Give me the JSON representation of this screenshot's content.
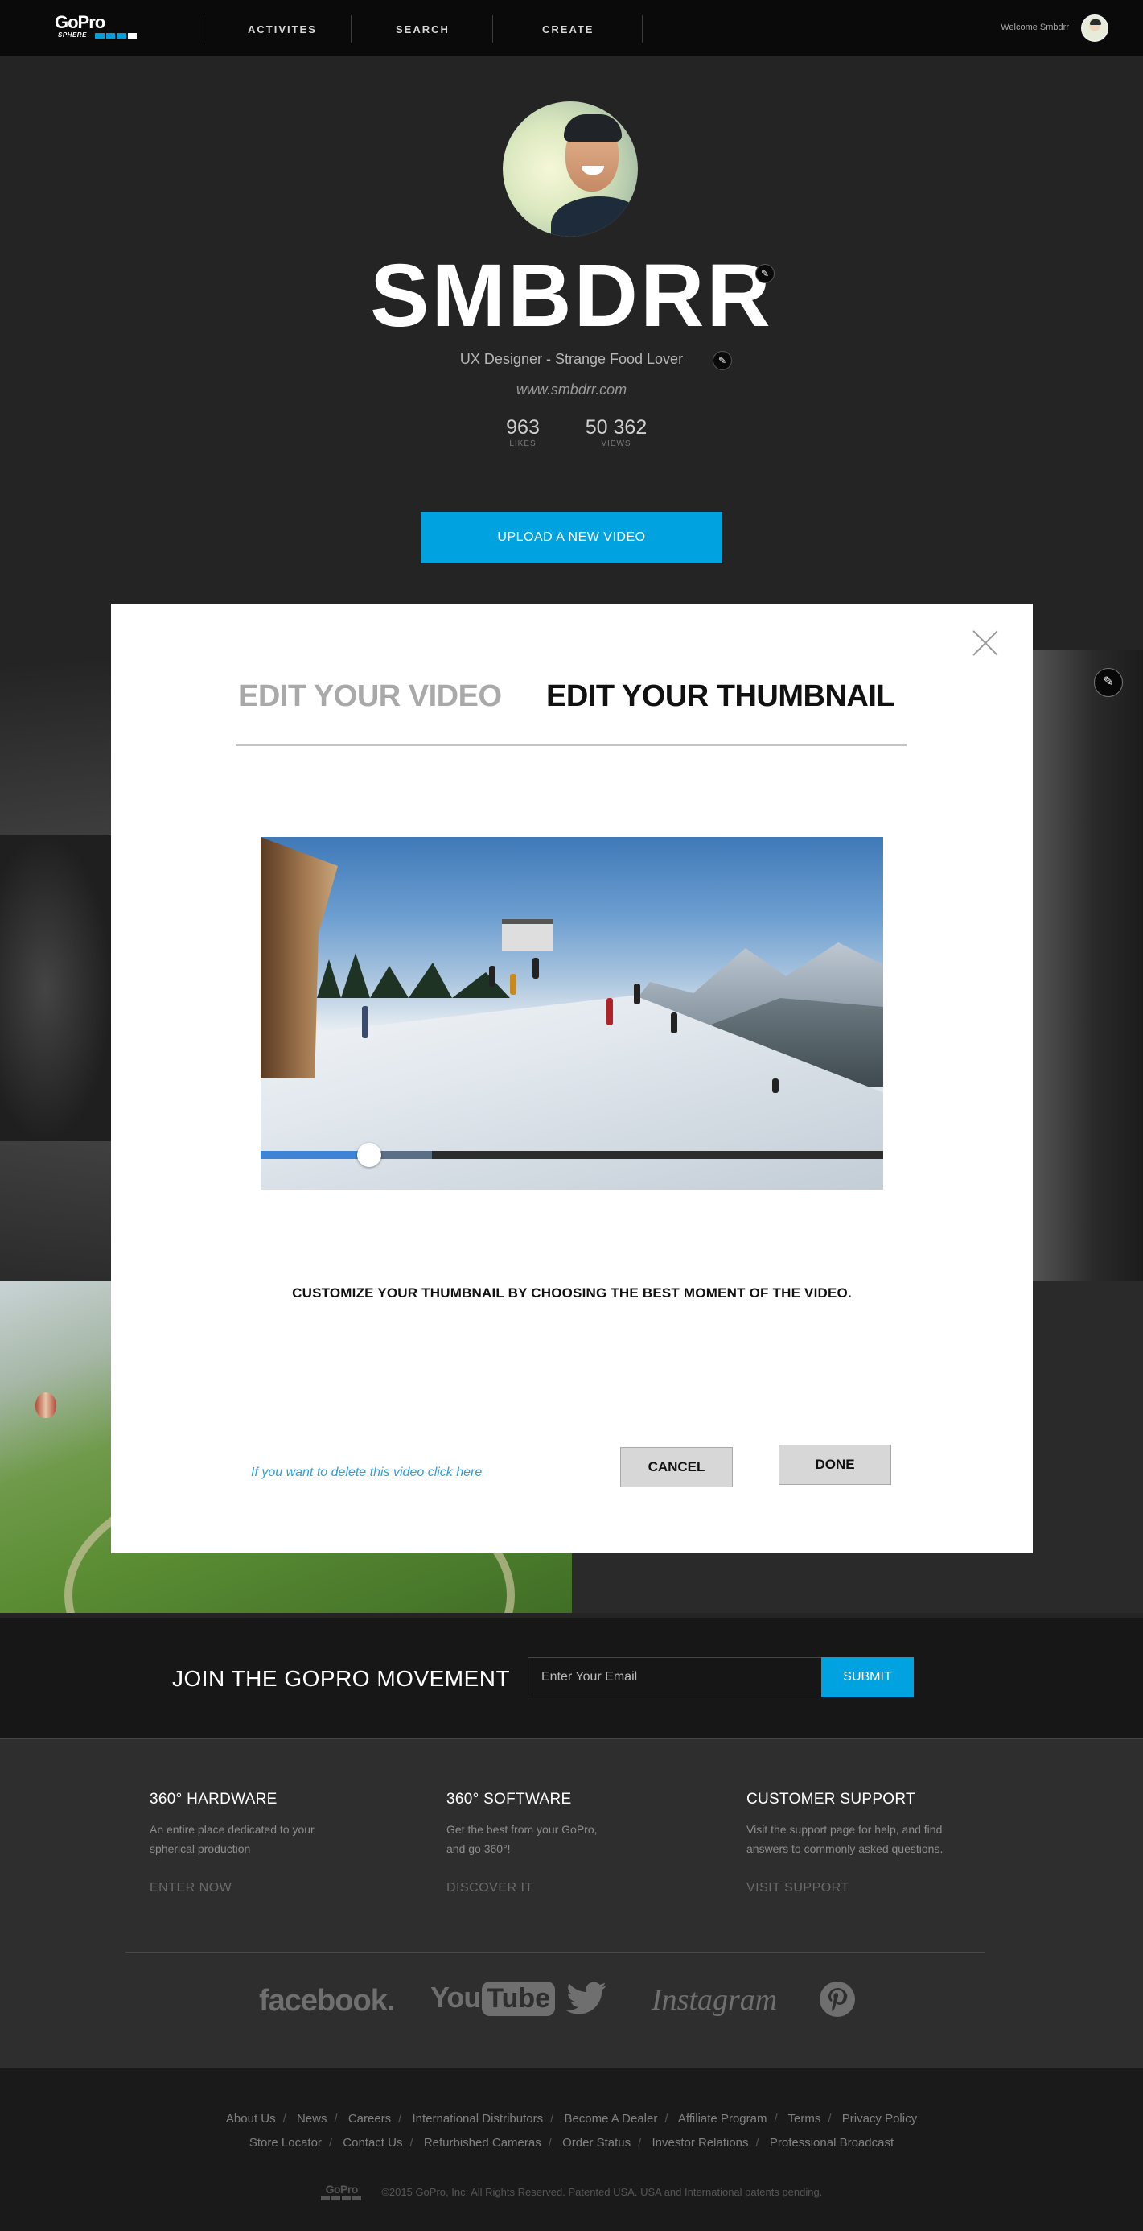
{
  "nav": {
    "brand": "GoPro",
    "brand_sub": "SPHERE",
    "links": [
      "ACTIVITES",
      "SEARCH",
      "CREATE"
    ],
    "welcome": "Welcome Smbdrr"
  },
  "profile": {
    "name": "SMBDRR",
    "bio": "UX Designer - Strange Food Lover",
    "website": "www.smbdrr.com",
    "likes": "963",
    "likes_label": "LIKES",
    "views": "50 362",
    "views_label": "VIEWS",
    "upload_label": "UPLOAD A NEW VIDEO"
  },
  "modal": {
    "tab_inactive": "EDIT YOUR VIDEO",
    "tab_active": "EDIT YOUR THUMBNAIL",
    "hint": "CUSTOMIZE YOUR THUMBNAIL BY CHOOSING THE BEST MOMENT OF THE VIDEO.",
    "delete_link": "If you want to delete this video click here",
    "cancel_label": "CANCEL",
    "done_label": "DONE",
    "scrubber_played_fraction": 0.175,
    "scrubber_buffered_fraction": 0.275
  },
  "join": {
    "title": "JOIN THE GOPRO MOVEMENT",
    "email_placeholder": "Enter Your Email",
    "submit_label": "SUBMIT"
  },
  "footer": {
    "columns": [
      {
        "title": "360° HARDWARE",
        "desc1": "An entire place dedicated to your",
        "desc2": "spherical production",
        "link": "ENTER NOW"
      },
      {
        "title": "360° SOFTWARE",
        "desc1": "Get the best from your GoPro,",
        "desc2": "and go 360°!",
        "link": "DISCOVER IT"
      },
      {
        "title": "CUSTOMER SUPPORT",
        "desc1": "Visit the support page for help, and find",
        "desc2": "answers to commonly asked questions.",
        "link": "VISIT SUPPORT"
      }
    ],
    "social": [
      "facebook",
      "YouTube",
      "twitter-bird-icon",
      "Instagram",
      "pinterest-icon"
    ],
    "social_text": {
      "facebook": "facebook.",
      "youtube_you": "You",
      "youtube_tube": "Tube",
      "instagram": "Instagram"
    },
    "links_row1": [
      "About Us",
      "News",
      "Careers",
      "International Distributors",
      "Become A Dealer",
      "Affiliate Program",
      "Terms",
      "Privacy Policy"
    ],
    "links_row2": [
      "Store Locator",
      "Contact Us",
      "Refurbished Cameras",
      "Order Status",
      "Investor Relations",
      "Professional Broadcast"
    ],
    "copyright": "©2015 GoPro, Inc. All Rights Reserved. Patented USA. USA and International patents pending.",
    "brand": "GoPro"
  },
  "colors": {
    "accent": "#00a3df",
    "link": "#2f9fd8",
    "scrubber": "#3d84d6"
  }
}
